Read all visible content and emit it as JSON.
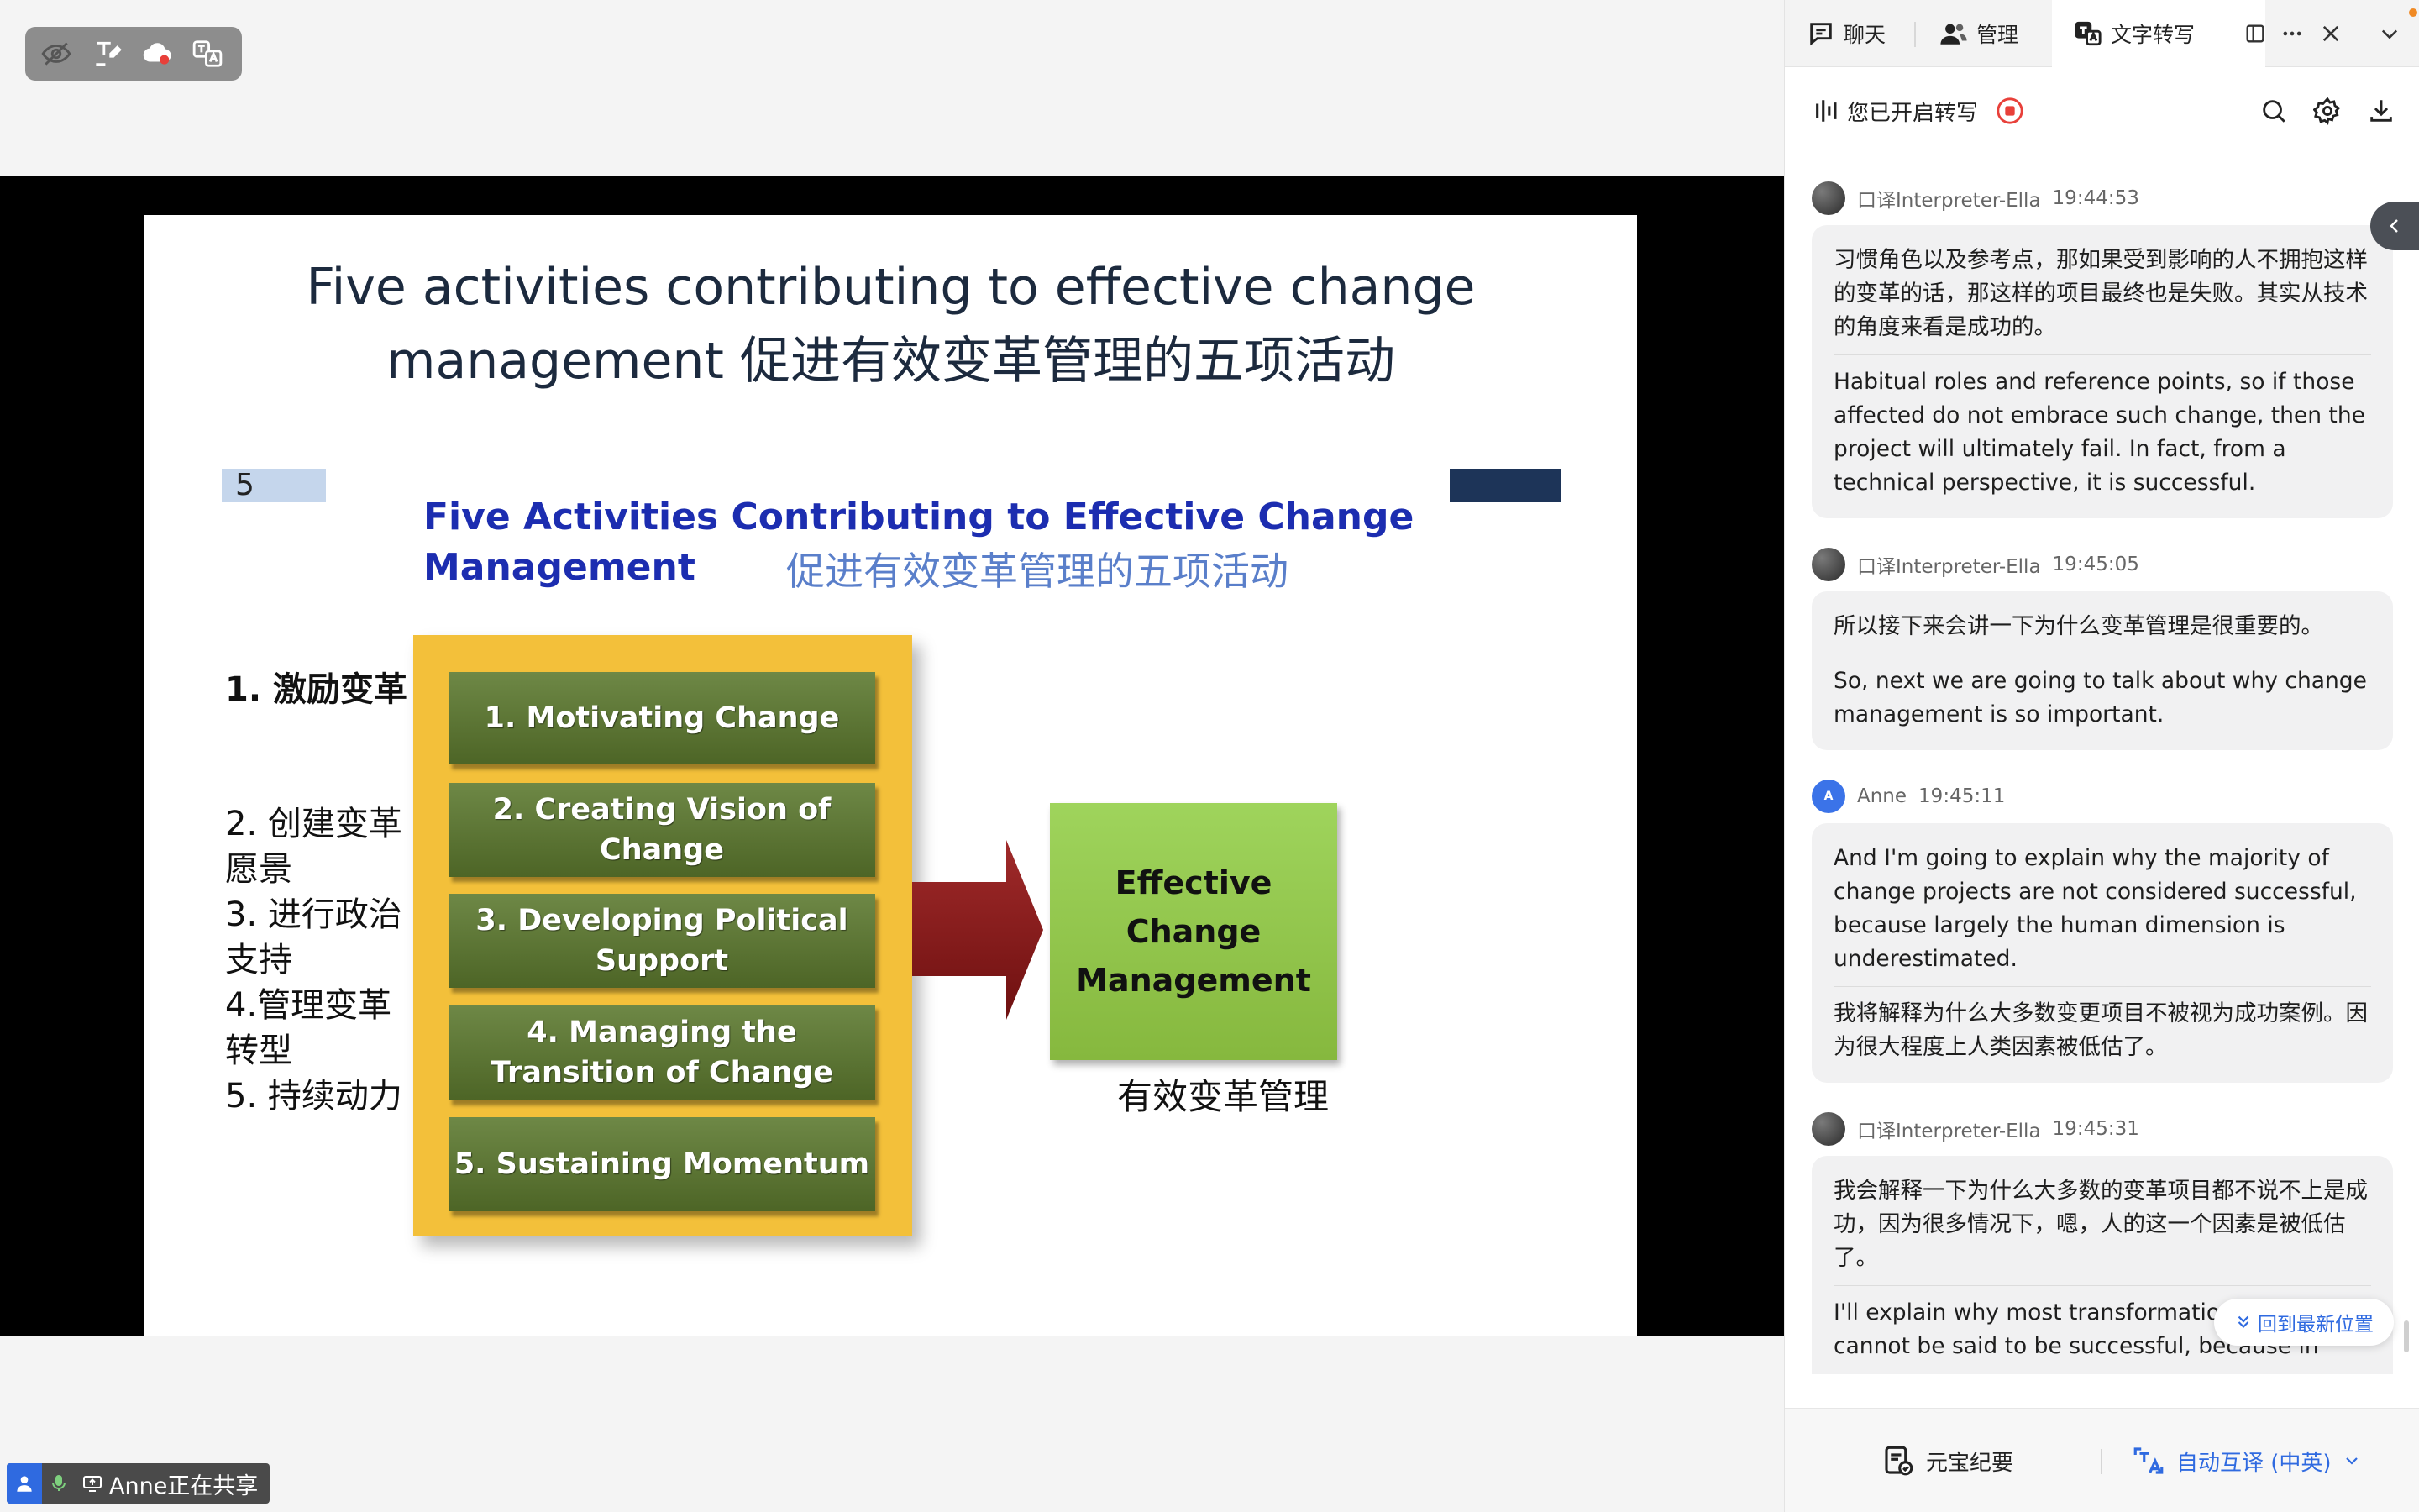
{
  "colors": {
    "accent_blue": "#2f6ae0",
    "record_red": "#e8403a",
    "slide_title": "#1c2a3e",
    "inner_title_blue": "#1c2db0",
    "inner_title_cn": "#5a7fca",
    "yellow_box": "#f3c03a",
    "green_bar": "#5a7432",
    "effective_green": "#93c74c",
    "arrow_red": "#8d1c1c"
  },
  "toolbar": {
    "icons": [
      "eye-off-icon",
      "annotate-icon",
      "cloud-record-icon",
      "translate-icon"
    ]
  },
  "slide": {
    "title_line1": "Five activities contributing to effective change",
    "title_line2": "management 促进有效变革管理的五项活动",
    "number": "5",
    "inner_title_en_line1": "Five Activities Contributing to Effective Change",
    "inner_title_en_line2": "Management",
    "inner_title_cn": "促进有效变革管理的五项活动",
    "cn_items": [
      "1. 激励变革",
      "2. 创建变革",
      "愿景",
      "3. 进行政治",
      "支持",
      "4.管理变革",
      "转型",
      "5. 持续动力"
    ],
    "activities": [
      "1.  Motivating Change",
      "2. Creating Vision of Change",
      "3. Developing Political Support",
      "4. Managing the Transition of Change",
      "5. Sustaining Momentum"
    ],
    "effective_label": "Effective Change Management",
    "effective_cn": "有效变革管理"
  },
  "share_badge": {
    "text": "Anne正在共享"
  },
  "panel": {
    "tabs": {
      "chat": "聊天",
      "manage": "管理",
      "transcribe": "文字转写"
    },
    "status_text": "您已开启转写",
    "entries": [
      {
        "speaker": "口译Interpreter-Ella",
        "time": "19:44:53",
        "segments": [
          "习惯角色以及参考点，那如果受到影响的人不拥抱这样的变革的话，那这样的项目最终也是失败。其实从技术的角度来看是成功的。",
          "Habitual roles and reference points, so if those affected do not embrace such change, then the project will ultimately fail. In fact, from a technical perspective, it is successful."
        ]
      },
      {
        "speaker": "口译Interpreter-Ella",
        "time": "19:45:05",
        "segments": [
          "所以接下来会讲一下为什么变革管理是很重要的。",
          "So, next we are going to talk about why change management is so important."
        ]
      },
      {
        "speaker": "Anne",
        "avatar_letter": "A",
        "time": "19:45:11",
        "segments": [
          "And I'm going to explain why the majority of change projects are not considered successful, because largely the human dimension is underestimated.",
          "我将解释为什么大多数变更项目不被视为成功案例。因为很大程度上人类因素被低估了。"
        ]
      },
      {
        "speaker": "口译Interpreter-Ella",
        "time": "19:45:31",
        "segments": [
          "我会解释一下为什么大多数的变革项目都不说不上是成功，因为很多情况下，嗯，人的这一个因素是被低估了。",
          "I'll explain why most transformation projects cannot be said to be successful, because in many"
        ]
      }
    ],
    "jump_latest": "回到最新位置",
    "bottom": {
      "summary": "元宝纪要",
      "auto_interpret": "自动互译 (中英)"
    }
  }
}
